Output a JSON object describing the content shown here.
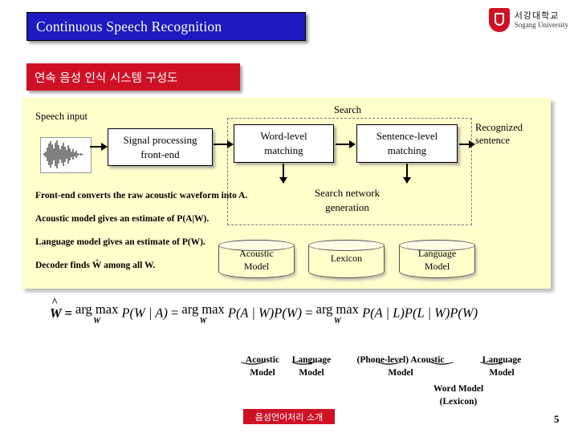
{
  "slide": {
    "title": "Continuous Speech Recognition",
    "subtitle_kr": "연속 음성 인식 시스템 구성도",
    "page_number": "5",
    "footer_label": "음성언어처리 소개"
  },
  "logo": {
    "korean": "서강대학교",
    "english": "Sogang University",
    "mark_color": "#cf1126"
  },
  "diagram": {
    "speech_input_label": "Speech input",
    "search_label": "Search",
    "recognized_label": "Recognized sentence",
    "boxes": [
      {
        "id": "signal",
        "label": "Signal processing\nfront-end"
      },
      {
        "id": "word",
        "label": "Word-level\nmatching"
      },
      {
        "id": "sentence",
        "label": "Sentence-level\nmatching"
      },
      {
        "id": "searchnet",
        "label": "Search network\ngeneration"
      }
    ],
    "databases": [
      {
        "id": "acoustic",
        "label": "Acoustic\nModel"
      },
      {
        "id": "lexicon",
        "label": "Lexicon"
      },
      {
        "id": "language",
        "label": "Language\nModel"
      }
    ],
    "bullets": [
      "Front-end converts the raw acoustic waveform into A.",
      "Acoustic model gives an estimate of P(A|W).",
      "Language model gives an estimate of P(W).",
      "Decoder finds Ŵ among all W."
    ]
  },
  "equation": {
    "parts": {
      "lhs": "Ŵ =",
      "argmax1": "arg max",
      "under1": "W",
      "term1": "P(W | A)",
      "eq2": "=",
      "argmax2": "arg max",
      "under2": "W",
      "term2": "P(A | W)P(W)",
      "eq3": "=",
      "argmax3": "arg max",
      "under3": "W",
      "term3": "P(A | L)P(L | W)P(W)"
    },
    "annotations": [
      {
        "id": "acoustic-model",
        "label": "Acoustic\nModel"
      },
      {
        "id": "language-model",
        "label": "Language\nModel"
      },
      {
        "id": "phone-acoustic",
        "label": "(Phone-level)\nAcoustic Model"
      },
      {
        "id": "word-model",
        "label": "Word Model\n(Lexicon)"
      },
      {
        "id": "language-model-2",
        "label": "Language\nModel"
      }
    ]
  },
  "colors": {
    "title_bg": "#1b1bbf",
    "accent_red": "#cf1126",
    "panel_bg": "#ffffcc"
  }
}
